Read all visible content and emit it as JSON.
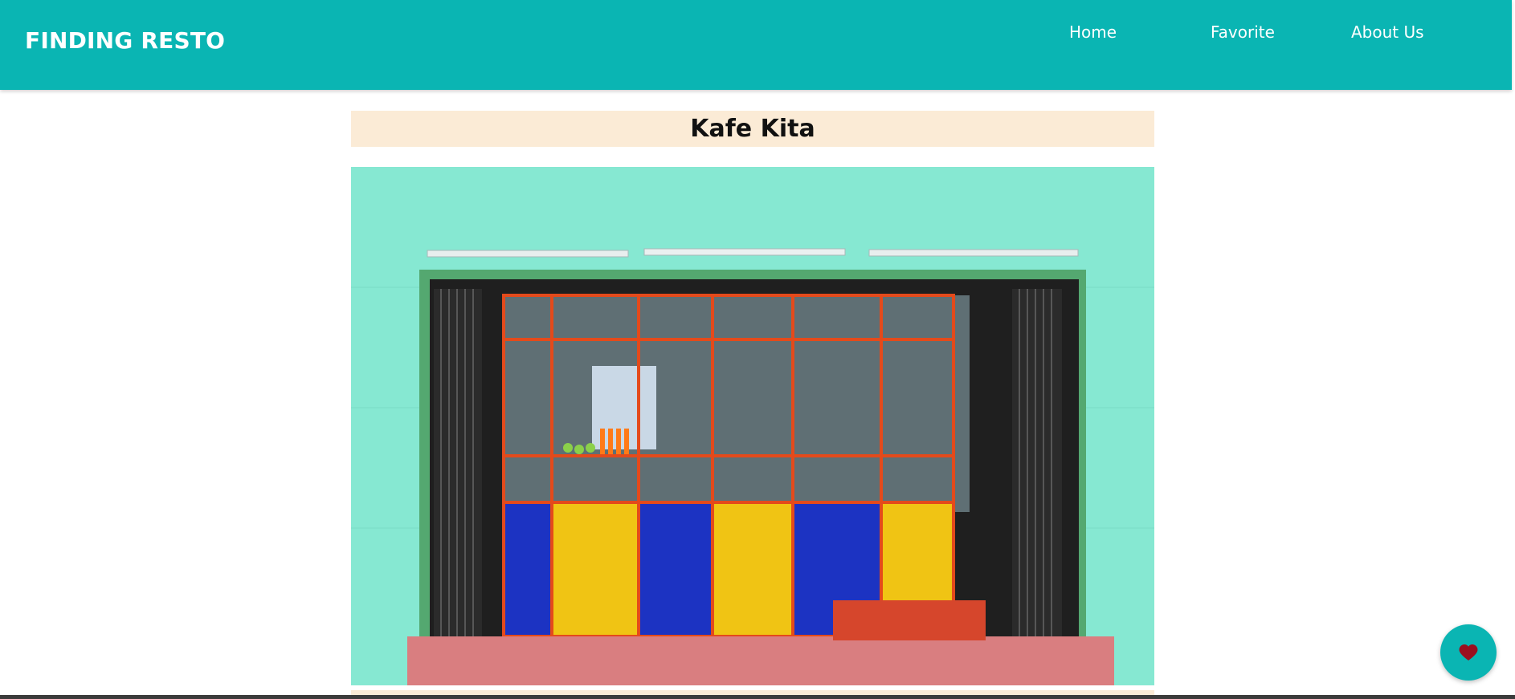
{
  "header": {
    "brand": "FINDING RESTO",
    "nav": [
      {
        "label": "Home"
      },
      {
        "label": "Favorite"
      },
      {
        "label": "About Us"
      }
    ]
  },
  "restaurant": {
    "name": "Kafe Kita"
  },
  "colors": {
    "header_bg": "#0ab5b3",
    "title_bg": "#fbebd6",
    "fab_bg": "#0ab5b3",
    "heart": "#9b0f1f"
  },
  "icons": {
    "favorite_button": "heart-icon"
  }
}
